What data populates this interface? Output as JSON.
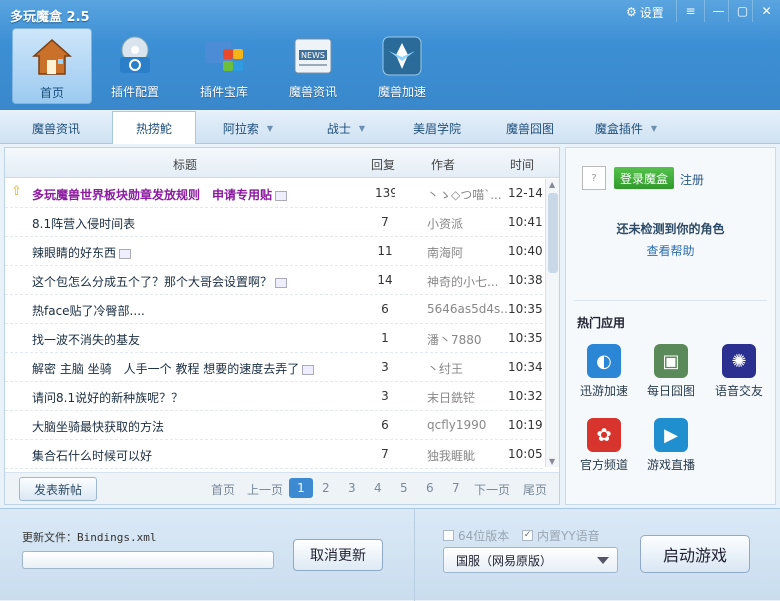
{
  "window": {
    "title": "多玩魔盒 2.5",
    "settings_label": "设置",
    "min": "—",
    "max": "▢",
    "close": "✕"
  },
  "nav": [
    {
      "label": "首页"
    },
    {
      "label": "插件配置"
    },
    {
      "label": "插件宝库"
    },
    {
      "label": "魔兽资讯"
    },
    {
      "label": "魔兽加速"
    }
  ],
  "tabs": [
    {
      "label": "魔兽资讯"
    },
    {
      "label": "热捞鮀"
    },
    {
      "label": "阿拉索"
    },
    {
      "label": "战士"
    },
    {
      "label": "美眉学院"
    },
    {
      "label": "魔兽囧图"
    },
    {
      "label": "魔盒插件"
    }
  ],
  "list": {
    "headers": {
      "title": "标题",
      "replies": "回复",
      "author": "作者",
      "time": "时间"
    },
    "rows": [
      {
        "title": "多玩魔兽世界板块勋章发放规则　申请专用贴",
        "replies": "139",
        "author": "丶ゝ◇つ喵`...",
        "time": "12-14",
        "pinned": true,
        "img": true
      },
      {
        "title": "8.1阵营入侵时间表",
        "replies": "7",
        "author": "小资派",
        "time": "10:41",
        "img": false
      },
      {
        "title": "辣眼睛的好东西",
        "replies": "11",
        "author": "南海阿",
        "time": "10:40",
        "img": true
      },
      {
        "title": "这个包怎么分成五个了？那个大哥会设置啊？",
        "replies": "14",
        "author": "神奇的小七...",
        "time": "10:38",
        "img": true
      },
      {
        "title": "热face贴了冷臀部....",
        "replies": "6",
        "author": "5646as5d4s...",
        "time": "10:35",
        "img": false
      },
      {
        "title": "找一波不消失的基友",
        "replies": "1",
        "author": "潘丶7880",
        "time": "10:35",
        "img": false
      },
      {
        "title": "解密 主脑 坐骑　人手一个 教程 想要的速度去弄了",
        "replies": "3",
        "author": "丶纣王",
        "time": "10:34",
        "img": true
      },
      {
        "title": "请问8.1说好的新种族呢？？",
        "replies": "3",
        "author": "末日銑铓",
        "time": "10:32",
        "img": false
      },
      {
        "title": "大脑坐骑最快获取的方法",
        "replies": "6",
        "author": "qcfly1990",
        "time": "10:19",
        "img": false
      },
      {
        "title": "集合石什么时候可以好",
        "replies": "7",
        "author": "独我睚眦",
        "time": "10:05",
        "img": false
      }
    ]
  },
  "pager": {
    "post_label": "发表新帖",
    "first": "首页",
    "prev": "上一页",
    "pages": [
      "1",
      "2",
      "3",
      "4",
      "5",
      "6",
      "7"
    ],
    "current": "1",
    "next": "下一页",
    "last": "尾页"
  },
  "side": {
    "avatar_text": "?",
    "login_label": "登录魔盒",
    "register_label": "注册",
    "no_role": "还未检测到你的角色",
    "help_link": "查看帮助",
    "hot_title": "热门应用",
    "apps": [
      {
        "label": "迅游加速",
        "icon": "xunyou-icon",
        "color": "#2b86d6"
      },
      {
        "label": "每日囧图",
        "icon": "photo-icon",
        "color": "#5a8a5a"
      },
      {
        "label": "语音交友",
        "icon": "octopus-icon",
        "color": "#2b2f8f"
      },
      {
        "label": "官方频道",
        "icon": "official-icon",
        "color": "#d6342c"
      },
      {
        "label": "游戏直播",
        "icon": "play-icon",
        "color": "#1f8fd0"
      }
    ]
  },
  "bottom": {
    "update_file": "更新文件：Bindings.xml",
    "cancel_label": "取消更新",
    "opt_64": "64位版本",
    "opt_yy": "内置YY语音",
    "opt_yy_checked": true,
    "server": "国服（网易原版）",
    "start_label": "启动游戏"
  }
}
